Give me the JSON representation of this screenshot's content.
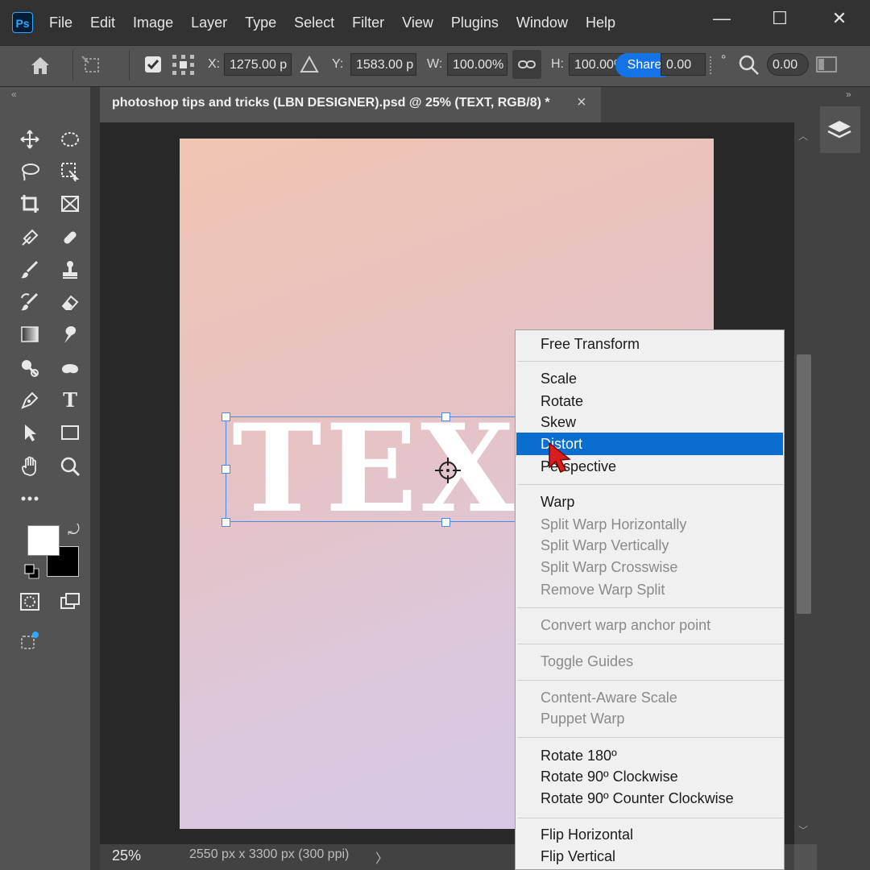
{
  "app": {
    "logo": "Ps"
  },
  "menubar": {
    "items": [
      "File",
      "Edit",
      "Image",
      "Layer",
      "Type",
      "Select",
      "Filter",
      "View",
      "Plugins",
      "Window",
      "Help"
    ]
  },
  "window": {
    "minimize": "—",
    "maximize": "☐",
    "close": "✕"
  },
  "options": {
    "x_label": "X:",
    "x_value": "1275.00 p",
    "y_label": "Y:",
    "y_value": "1583.00 p",
    "w_label": "W:",
    "w_value": "100.00%",
    "h_label": "H:",
    "h_value": "100.00%",
    "share_label": "Share",
    "angle_value": "0.00",
    "degree": "°",
    "skew_value": "0.00"
  },
  "document": {
    "tab_title": "photoshop tips and tricks (LBN DESIGNER).psd @ 25% (TEXT, RGB/8) *",
    "tab_close": "×",
    "canvas_text": "TEXT",
    "zoom": "25%",
    "info": "2550 px x 3300 px (300 ppi)",
    "status_arrow": "〉"
  },
  "context_menu": {
    "groups": [
      [
        {
          "label": "Free Transform",
          "enabled": true
        }
      ],
      [
        {
          "label": "Scale",
          "enabled": true
        },
        {
          "label": "Rotate",
          "enabled": true
        },
        {
          "label": "Skew",
          "enabled": true
        },
        {
          "label": "Distort",
          "enabled": true,
          "highlighted": true
        },
        {
          "label": "Perspective",
          "enabled": true
        }
      ],
      [
        {
          "label": "Warp",
          "enabled": true
        },
        {
          "label": "Split Warp Horizontally",
          "enabled": false
        },
        {
          "label": "Split Warp Vertically",
          "enabled": false
        },
        {
          "label": "Split Warp Crosswise",
          "enabled": false
        },
        {
          "label": "Remove Warp Split",
          "enabled": false
        }
      ],
      [
        {
          "label": "Convert warp anchor point",
          "enabled": false
        }
      ],
      [
        {
          "label": "Toggle Guides",
          "enabled": false
        }
      ],
      [
        {
          "label": "Content-Aware Scale",
          "enabled": false
        },
        {
          "label": "Puppet Warp",
          "enabled": false
        }
      ],
      [
        {
          "label": "Rotate 180º",
          "enabled": true
        },
        {
          "label": "Rotate 90º Clockwise",
          "enabled": true
        },
        {
          "label": "Rotate 90º Counter Clockwise",
          "enabled": true
        }
      ],
      [
        {
          "label": "Flip Horizontal",
          "enabled": true
        },
        {
          "label": "Flip Vertical",
          "enabled": true
        }
      ]
    ]
  },
  "colors": {
    "accent": "#0a6ed1",
    "share": "#1473e6",
    "foreground": "#ffffff",
    "background": "#000000"
  }
}
